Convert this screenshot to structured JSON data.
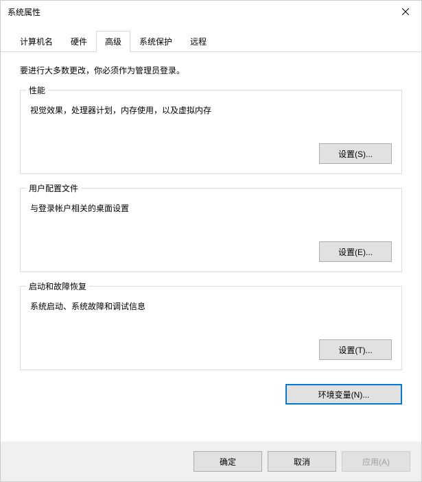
{
  "window": {
    "title": "系统属性"
  },
  "tabs": {
    "computer_name": "计算机名",
    "hardware": "硬件",
    "advanced": "高级",
    "system_protection": "系统保护",
    "remote": "远程"
  },
  "content": {
    "intro": "要进行大多数更改，你必须作为管理员登录。"
  },
  "performance": {
    "title": "性能",
    "desc": "视觉效果，处理器计划，内存使用，以及虚拟内存",
    "button": "设置(S)..."
  },
  "user_profiles": {
    "title": "用户配置文件",
    "desc": "与登录帐户相关的桌面设置",
    "button": "设置(E)..."
  },
  "startup": {
    "title": "启动和故障恢复",
    "desc": "系统启动、系统故障和调试信息",
    "button": "设置(T)..."
  },
  "env": {
    "button": "环境变量(N)..."
  },
  "footer": {
    "ok": "确定",
    "cancel": "取消",
    "apply": "应用(A)"
  }
}
